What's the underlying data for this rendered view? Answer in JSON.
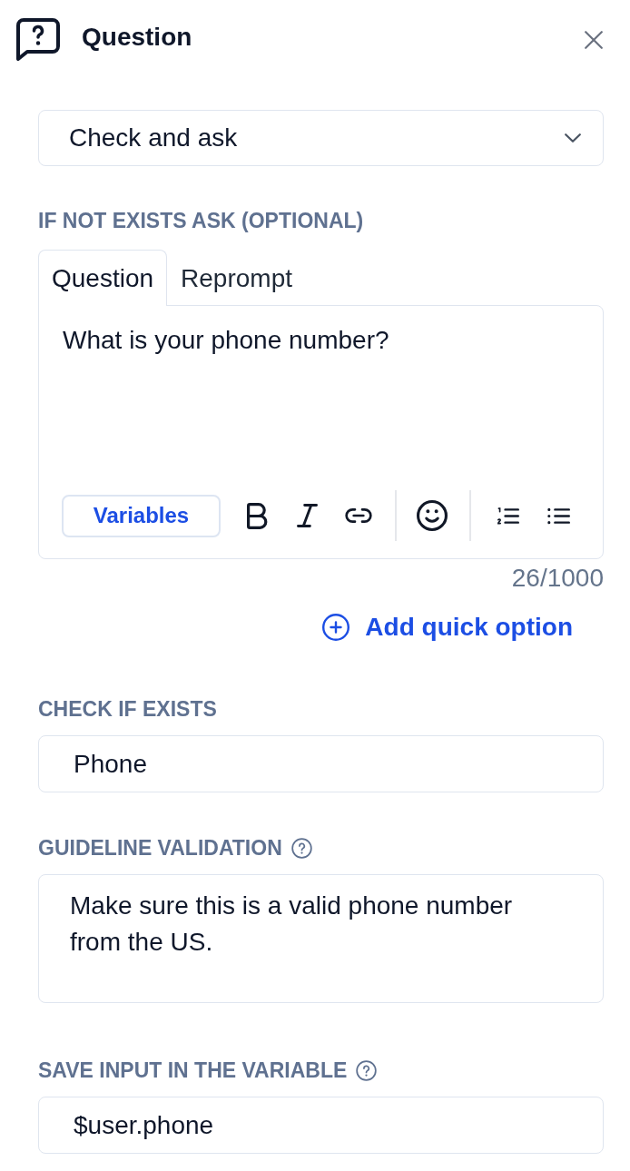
{
  "header": {
    "title": "Question"
  },
  "mode_select": {
    "value": "Check and ask"
  },
  "ask": {
    "label": "IF NOT EXISTS ASK (OPTIONAL)",
    "tabs": [
      {
        "label": "Question",
        "selected": true
      },
      {
        "label": "Reprompt",
        "selected": false
      }
    ],
    "editor": {
      "value": "What is your phone number?",
      "variables_button": "Variables"
    },
    "counter": "26/1000",
    "add_option": "Add quick option"
  },
  "fields": [
    {
      "label": "CHECK IF EXISTS",
      "help": false,
      "kind": "input",
      "value": "Phone"
    },
    {
      "label": "GUIDELINE VALIDATION",
      "help": true,
      "kind": "textarea",
      "value": "Make sure this is a valid phone number from the US."
    },
    {
      "label": "SAVE INPUT IN THE VARIABLE",
      "help": true,
      "kind": "input",
      "value": "$user.phone"
    }
  ]
}
